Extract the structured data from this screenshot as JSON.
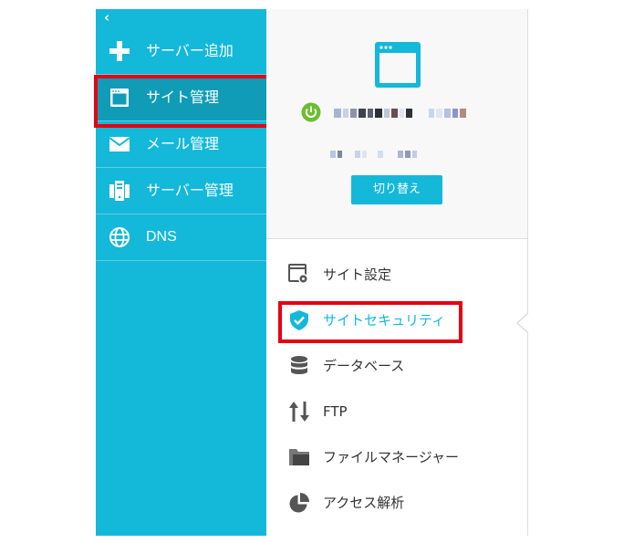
{
  "sidebar": {
    "collapse_glyph": "‹",
    "items": [
      {
        "label": "サーバー追加",
        "icon": "plus-icon"
      },
      {
        "label": "サイト管理",
        "icon": "window-icon"
      },
      {
        "label": "メール管理",
        "icon": "mail-icon"
      },
      {
        "label": "サーバー管理",
        "icon": "server-icon"
      },
      {
        "label": "DNS",
        "icon": "globe-icon"
      }
    ],
    "active_index": 1
  },
  "site_panel": {
    "switch_button_label": "切り替え",
    "status_color": "#6cbe2f"
  },
  "menu": {
    "items": [
      {
        "label": "サイト設定",
        "icon": "site-settings-icon"
      },
      {
        "label": "サイトセキュリティ",
        "icon": "shield-check-icon"
      },
      {
        "label": "データベース",
        "icon": "database-icon"
      },
      {
        "label": "FTP",
        "icon": "transfer-arrows-icon"
      },
      {
        "label": "ファイルマネージャー",
        "icon": "folder-icon"
      },
      {
        "label": "アクセス解析",
        "icon": "pie-chart-icon"
      }
    ],
    "active_index": 1
  },
  "colors": {
    "accent": "#14b8d9",
    "active_sidebar": "#109bb7",
    "highlight": "#e60012",
    "icon_gray": "#555555"
  }
}
